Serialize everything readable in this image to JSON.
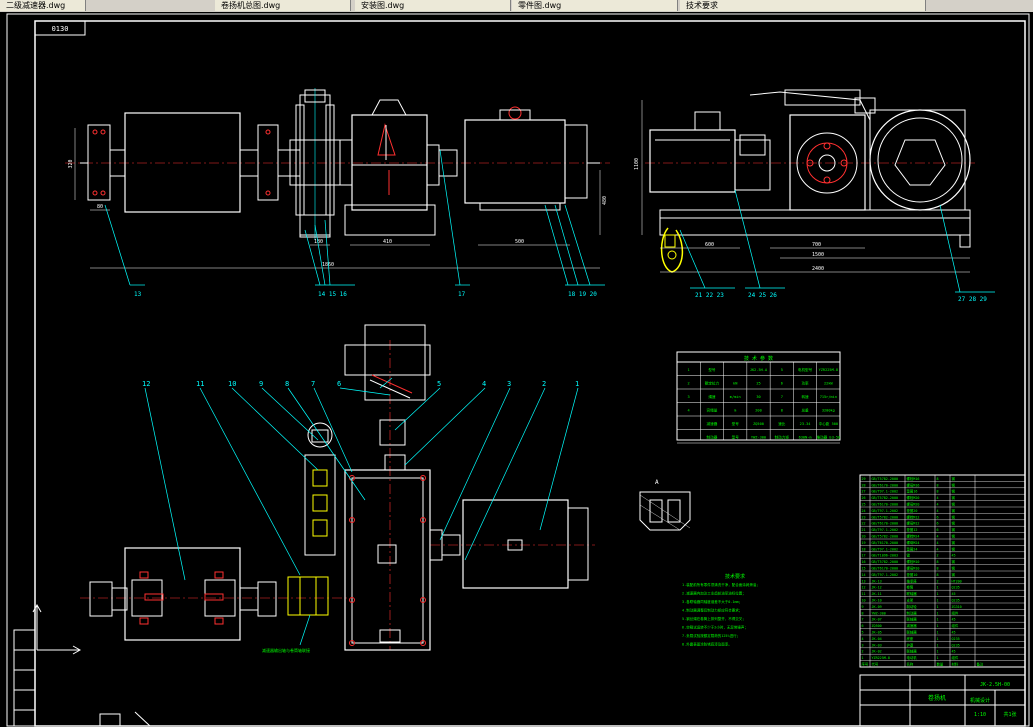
{
  "window": {
    "tabs": [
      {
        "label": "二级减速器.dwg"
      },
      {
        "label": "卷扬机总图.dwg"
      },
      {
        "label": "安装图.dwg"
      },
      {
        "label": "零件图.dwg"
      },
      {
        "label": "技术要求"
      }
    ]
  },
  "drawing": {
    "code_box": "0130",
    "left_view_labels": {
      "dim_span": "320",
      "dim_small": "80",
      "dim_front": "180",
      "dim_gear": "410",
      "dim_motor": "500",
      "dim_total": "1860",
      "dim_height": "480",
      "callout_13": "13",
      "callout_14": "14 15 16",
      "callout_17": "17",
      "callout_18": "18 19 20"
    },
    "right_view_labels": {
      "dim_height": "1100",
      "dim_a": "600",
      "dim_b": "700",
      "dim_c": "1500",
      "dim_total": "2400",
      "callout_21": "21 22 23",
      "callout_24": "24 25 26",
      "callout_27": "27 28 29"
    },
    "plan_view_labels": {
      "callouts": [
        "12",
        "11",
        "10",
        "9",
        "8",
        "7",
        "6",
        "5",
        "4",
        "3",
        "2",
        "1"
      ],
      "note": "减速器输出轴与卷筒轴联接"
    },
    "section_label": "A",
    "tech_table": {
      "title": "技 术 参 数",
      "rows": [
        [
          "1",
          "型号",
          "",
          "JK2.5H-A",
          "5",
          "电机型号",
          "YZR225M-8"
        ],
        [
          "2",
          "额定拉力",
          "kN",
          "25",
          "6",
          "功率",
          "22kW"
        ],
        [
          "3",
          "绳速",
          "m/min",
          "30",
          "7",
          "转速",
          "715r/min"
        ],
        [
          "4",
          "容绳量",
          "m",
          "200",
          "8",
          "总重",
          "3200kg"
        ],
        [
          "",
          "减速器",
          "型号",
          "ZQ500",
          "速比",
          "23.34",
          "中心距 500"
        ],
        [
          "",
          "制动器",
          "型号",
          "YWZ-300",
          "制动力矩",
          "630N·m",
          "推动器 Ed-50"
        ]
      ]
    },
    "tech_notes": {
      "title": "技术要求",
      "lines": [
        "1.装配前所有零件须清洗干净，配合面涂润滑油；",
        "2.减速器内加注工业齿轮油至油标位置；",
        "3.各联轴器同轴度误差不大于0.1mm；",
        "4.制动器调整后制动力矩应符合要求；",
        "5.钢丝绳在卷筒上排列整齐，不得交叉；",
        "6.空载试运转不少于2小时，无异常噪声；",
        "7.负载试验按额定载荷的125%进行；",
        "8.外露表面涂防锈底漆及面漆。"
      ]
    },
    "parts_list": {
      "rows": [
        [
          "29",
          "GB/T5782-2000",
          "螺栓M16",
          "8",
          "钢",
          ""
        ],
        [
          "28",
          "GB/T6170-2000",
          "螺母M16",
          "8",
          "钢",
          ""
        ],
        [
          "27",
          "GB/T97.1-2002",
          "垫圈16",
          "8",
          "钢",
          ""
        ],
        [
          "26",
          "GB/T5782-2000",
          "螺栓M20",
          "4",
          "钢",
          ""
        ],
        [
          "25",
          "GB/T6170-2000",
          "螺母M20",
          "4",
          "钢",
          ""
        ],
        [
          "24",
          "GB/T97.1-2002",
          "垫圈20",
          "4",
          "钢",
          ""
        ],
        [
          "23",
          "GB/T5782-2000",
          "螺栓M12",
          "6",
          "钢",
          ""
        ],
        [
          "22",
          "GB/T6170-2000",
          "螺母M12",
          "6",
          "钢",
          ""
        ],
        [
          "21",
          "GB/T97.1-2002",
          "垫圈12",
          "6",
          "钢",
          ""
        ],
        [
          "20",
          "GB/T5782-2000",
          "螺栓M24",
          "4",
          "钢",
          ""
        ],
        [
          "19",
          "GB/T6170-2000",
          "螺母M24",
          "4",
          "钢",
          ""
        ],
        [
          "18",
          "GB/T97.1-2002",
          "垫圈24",
          "4",
          "钢",
          ""
        ],
        [
          "17",
          "GB/T1096-2003",
          "键",
          "2",
          "45",
          ""
        ],
        [
          "16",
          "GB/T5782-2000",
          "螺栓M10",
          "8",
          "钢",
          ""
        ],
        [
          "15",
          "GB/T6170-2000",
          "螺母M10",
          "8",
          "钢",
          ""
        ],
        [
          "14",
          "GB/T97.1-2002",
          "垫圈10",
          "8",
          "钢",
          ""
        ],
        [
          "13",
          "JK-13",
          "轴承座",
          "2",
          "HT200",
          ""
        ],
        [
          "12",
          "JK-12",
          "卷筒",
          "1",
          "Q235",
          ""
        ],
        [
          "11",
          "JK-11",
          "联轴器",
          "1",
          "45",
          ""
        ],
        [
          "10",
          "JK-10",
          "支架",
          "1",
          "Q235",
          ""
        ],
        [
          "9",
          "JK-09",
          "制动轮",
          "1",
          "ZG310",
          ""
        ],
        [
          "8",
          "YWZ-300",
          "制动器",
          "1",
          "组件",
          ""
        ],
        [
          "7",
          "JK-07",
          "联轴器",
          "1",
          "45",
          ""
        ],
        [
          "6",
          "ZQ500",
          "减速器",
          "1",
          "组件",
          ""
        ],
        [
          "5",
          "JK-05",
          "联轴器",
          "1",
          "45",
          ""
        ],
        [
          "4",
          "JK-04",
          "底座",
          "1",
          "Q235",
          ""
        ],
        [
          "3",
          "JK-03",
          "护罩",
          "1",
          "Q235",
          ""
        ],
        [
          "2",
          "JK-02",
          "联轴器",
          "1",
          "45",
          ""
        ],
        [
          "1",
          "YZR225M-8",
          "电动机",
          "1",
          "组件",
          ""
        ]
      ],
      "header": [
        "序号",
        "代号",
        "名称",
        "数量",
        "材料",
        "备注"
      ]
    },
    "title_block": {
      "name": "卷扬机",
      "drawing_no": "JK-2.5H-00",
      "school": "机械设计",
      "scale": "1:10",
      "sheet": "共1张"
    }
  }
}
